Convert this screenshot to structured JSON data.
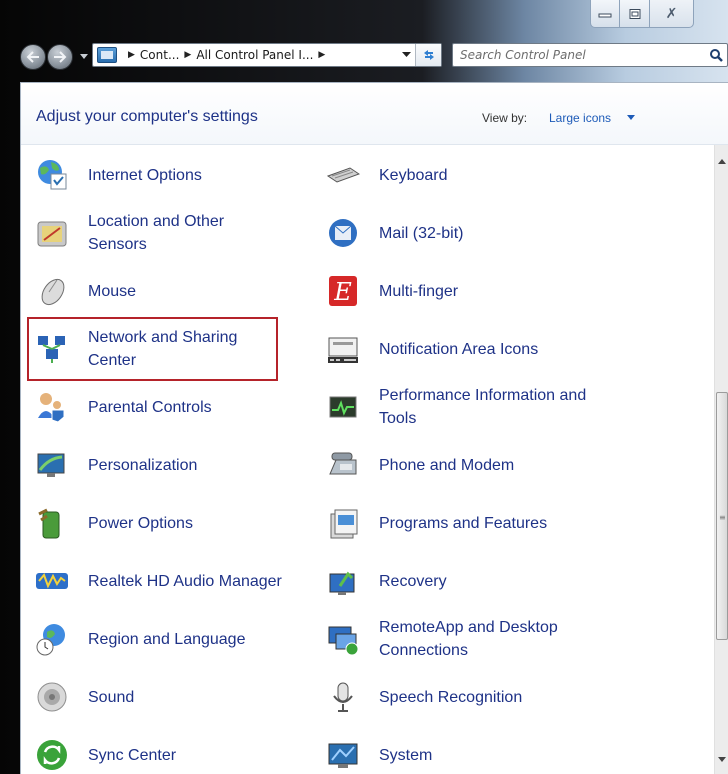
{
  "window": {
    "close_symbol": "✗"
  },
  "address_bar": {
    "crumbs": [
      "Cont...",
      "All Control Panel I..."
    ]
  },
  "search": {
    "placeholder": "Search Control Panel"
  },
  "toolbar": {
    "title": "Adjust your computer's settings",
    "view_by_label": "View by:",
    "view_by_value": "Large icons"
  },
  "items_left": [
    {
      "label": "Internet Options",
      "icon": "internet-options-icon"
    },
    {
      "label": "Location and Other Sensors",
      "icon": "location-sensors-icon"
    },
    {
      "label": "Mouse",
      "icon": "mouse-icon"
    },
    {
      "label": "Network and Sharing Center",
      "icon": "network-icon",
      "highlighted": true
    },
    {
      "label": "Parental Controls",
      "icon": "parental-controls-icon"
    },
    {
      "label": "Personalization",
      "icon": "personalization-icon"
    },
    {
      "label": "Power Options",
      "icon": "power-options-icon"
    },
    {
      "label": "Realtek HD Audio Manager",
      "icon": "realtek-audio-icon"
    },
    {
      "label": "Region and Language",
      "icon": "region-language-icon"
    },
    {
      "label": "Sound",
      "icon": "sound-icon"
    },
    {
      "label": "Sync Center",
      "icon": "sync-center-icon"
    }
  ],
  "items_right": [
    {
      "label": "Keyboard",
      "icon": "keyboard-icon"
    },
    {
      "label": "Mail (32-bit)",
      "icon": "mail-icon"
    },
    {
      "label": "Multi-finger",
      "icon": "multi-finger-icon"
    },
    {
      "label": "Notification Area Icons",
      "icon": "notification-area-icon"
    },
    {
      "label": "Performance Information and Tools",
      "icon": "performance-icon"
    },
    {
      "label": "Phone and Modem",
      "icon": "phone-modem-icon"
    },
    {
      "label": "Programs and Features",
      "icon": "programs-features-icon"
    },
    {
      "label": "Recovery",
      "icon": "recovery-icon"
    },
    {
      "label": "RemoteApp and Desktop Connections",
      "icon": "remoteapp-icon"
    },
    {
      "label": "Speech Recognition",
      "icon": "speech-recognition-icon"
    },
    {
      "label": "System",
      "icon": "system-icon"
    }
  ],
  "colors": {
    "link": "#1e3287",
    "highlight_border": "#b5232a",
    "accent_blue": "#1e5bb8"
  }
}
